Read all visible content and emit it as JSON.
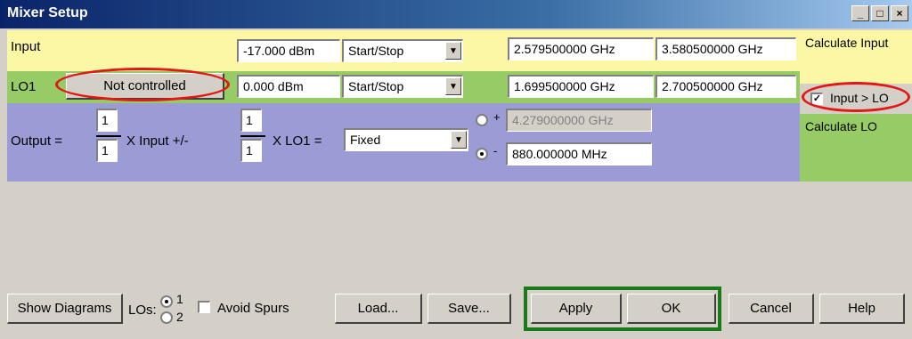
{
  "window": {
    "title": "Mixer Setup",
    "controls": {
      "minimize": "_",
      "maximize": "□",
      "close": "×"
    }
  },
  "input_row": {
    "label": "Input",
    "power": "-17.000 dBm",
    "mode": "Start/Stop",
    "start": "2.579500000 GHz",
    "stop": "3.580500000 GHz"
  },
  "lo1_row": {
    "label": "LO1",
    "control_button": "Not controlled",
    "power": "0.000 dBm",
    "mode": "Start/Stop",
    "start": "1.699500000 GHz",
    "stop": "2.700500000 GHz"
  },
  "output_row": {
    "label": "Output  =",
    "input_num": "1",
    "input_den": "1",
    "x_input": "X Input +/-",
    "lo_num": "1",
    "lo_den": "1",
    "x_lo": "X LO1 =",
    "mode": "Fixed",
    "plus_sign": "+",
    "minus_sign": "-",
    "plus_value": "4.279000000 GHz",
    "minus_value": "880.000000 MHz",
    "selected": "minus"
  },
  "side": {
    "calculate_input": "Calculate Input",
    "input_gt_lo": "Input > LO",
    "input_gt_lo_checked": true,
    "calculate_lo": "Calculate LO"
  },
  "bottom": {
    "show_diagrams": "Show Diagrams",
    "los_label": "LOs:",
    "lo_option_1": "1",
    "lo_option_2": "2",
    "lo_selected": "1",
    "avoid_spurs": "Avoid Spurs",
    "avoid_spurs_checked": false,
    "load": "Load...",
    "save": "Save...",
    "apply": "Apply",
    "ok": "OK",
    "cancel": "Cancel",
    "help": "Help"
  },
  "colors": {
    "input_row": "#fbf7a5",
    "lo1_row": "#97cb65",
    "output_row": "#9b9bd6",
    "highlight_oval": "#e01818",
    "apply_ok_frame": "#1a7a1a"
  }
}
